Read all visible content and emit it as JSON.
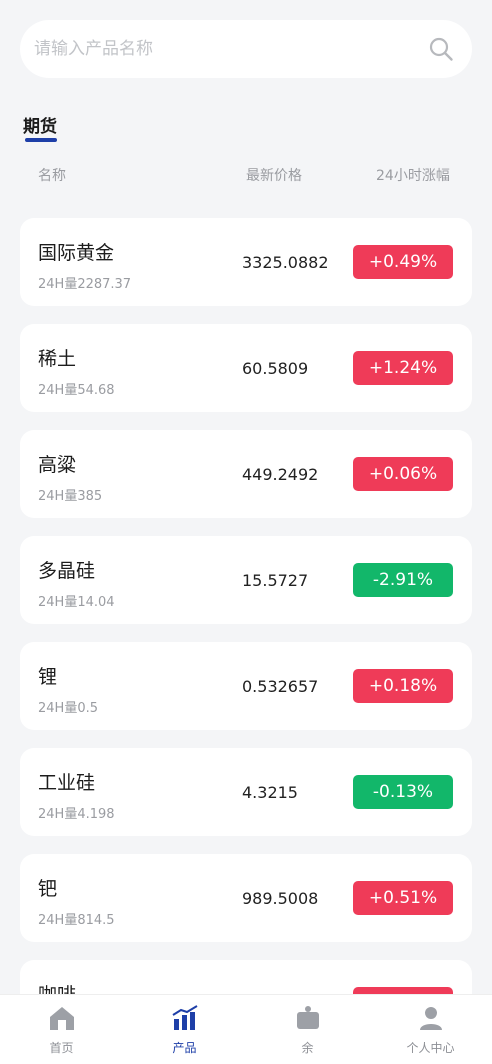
{
  "search": {
    "placeholder": "请输入产品名称"
  },
  "section": {
    "title": "期货"
  },
  "columns": {
    "name": "名称",
    "price": "最新价格",
    "change": "24小时涨幅"
  },
  "items": [
    {
      "name": "国际黄金",
      "volume": "24H量2287.37",
      "price": "3325.0882",
      "change": "+0.49%",
      "direction": "up"
    },
    {
      "name": "稀土",
      "volume": "24H量54.68",
      "price": "60.5809",
      "change": "+1.24%",
      "direction": "up"
    },
    {
      "name": "高粱",
      "volume": "24H量385",
      "price": "449.2492",
      "change": "+0.06%",
      "direction": "up"
    },
    {
      "name": "多晶硅",
      "volume": "24H量14.04",
      "price": "15.5727",
      "change": "-2.91%",
      "direction": "down"
    },
    {
      "name": "锂",
      "volume": "24H量0.5",
      "price": "0.532657",
      "change": "+0.18%",
      "direction": "up"
    },
    {
      "name": "工业硅",
      "volume": "24H量4.198",
      "price": "4.3215",
      "change": "-0.13%",
      "direction": "down"
    },
    {
      "name": "钯",
      "volume": "24H量814.5",
      "price": "989.5008",
      "change": "+0.51%",
      "direction": "up"
    },
    {
      "name": "咖啡",
      "volume": "",
      "price": "",
      "change": "",
      "direction": "up"
    }
  ],
  "tabbar": [
    {
      "label": "首页",
      "icon": "home-icon",
      "active": false
    },
    {
      "label": "产品",
      "icon": "chart-icon",
      "active": true
    },
    {
      "label": "余",
      "icon": "wallet-icon",
      "active": false
    },
    {
      "label": "个人中心",
      "icon": "user-icon",
      "active": false
    }
  ],
  "colors": {
    "up": "#ef3b58",
    "down": "#12b76a",
    "accent": "#1e3fa8"
  }
}
